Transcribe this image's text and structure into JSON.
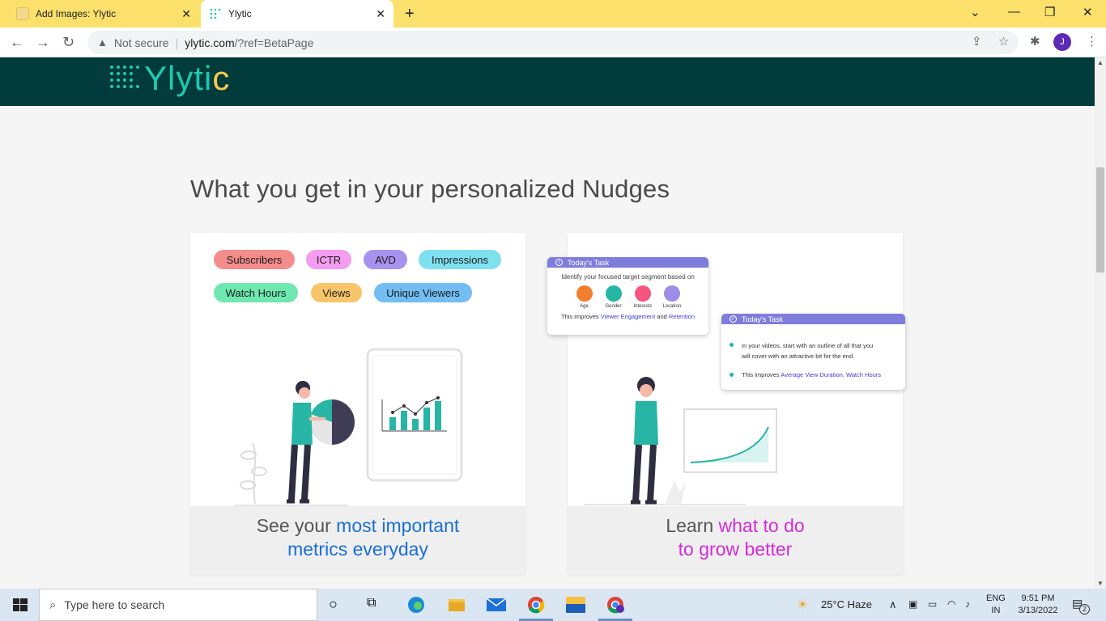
{
  "browser": {
    "tabs": [
      {
        "title": "Add Images: Ylytic",
        "active": false
      },
      {
        "title": "Ylytic",
        "active": true
      }
    ],
    "address": {
      "security": "Not secure",
      "host": "ylytic.com",
      "query": "/?ref=BetaPage"
    },
    "profile_initial": "J"
  },
  "site": {
    "logo": {
      "main": "Ylyti",
      "accent": "c"
    },
    "heading": "What you get in your personalized Nudges",
    "card1": {
      "chips": [
        {
          "label": "Subscribers",
          "color": "#f58c8c"
        },
        {
          "label": "ICTR",
          "color": "#f49cf0"
        },
        {
          "label": "AVD",
          "color": "#a792f0"
        },
        {
          "label": "Impressions",
          "color": "#7fe0f0"
        },
        {
          "label": "Watch Hours",
          "color": "#6ee8b0"
        },
        {
          "label": "Views",
          "color": "#f8c66a"
        },
        {
          "label": "Unique Viewers",
          "color": "#72bdf2"
        }
      ],
      "caption": {
        "plain": "See your ",
        "highlight1": "most important",
        "highlight2": "metrics everyday"
      }
    },
    "card2": {
      "task1": {
        "title": "Today's Task",
        "text": "Identify your focused target segment based on",
        "segments": [
          {
            "label": "Age",
            "color": "#f27d2c"
          },
          {
            "label": "Gender",
            "color": "#27b5a5"
          },
          {
            "label": "Interests",
            "color": "#f5557e"
          },
          {
            "label": "Location",
            "color": "#9c8ee8"
          }
        ],
        "improves": "This improves",
        "link1": "Viewer Engagement",
        "and": "and",
        "link2": "Retention"
      },
      "task2": {
        "title": "Today's Task",
        "bullet1_line1": "In your videos, start with an outline of all that you",
        "bullet1_line2": "will cover with an attractive bit for the end.",
        "improves": "This improves",
        "link": "Average View Duration, Watch Hours"
      },
      "caption": {
        "plain": "Learn ",
        "highlight1": "what to do",
        "highlight2": "to grow better"
      }
    }
  },
  "taskbar": {
    "search_placeholder": "Type here to search",
    "weather": "25°C  Haze",
    "lang1": "ENG",
    "lang2": "IN",
    "time": "9:51 PM",
    "date": "3/13/2022",
    "notifications": "2"
  }
}
